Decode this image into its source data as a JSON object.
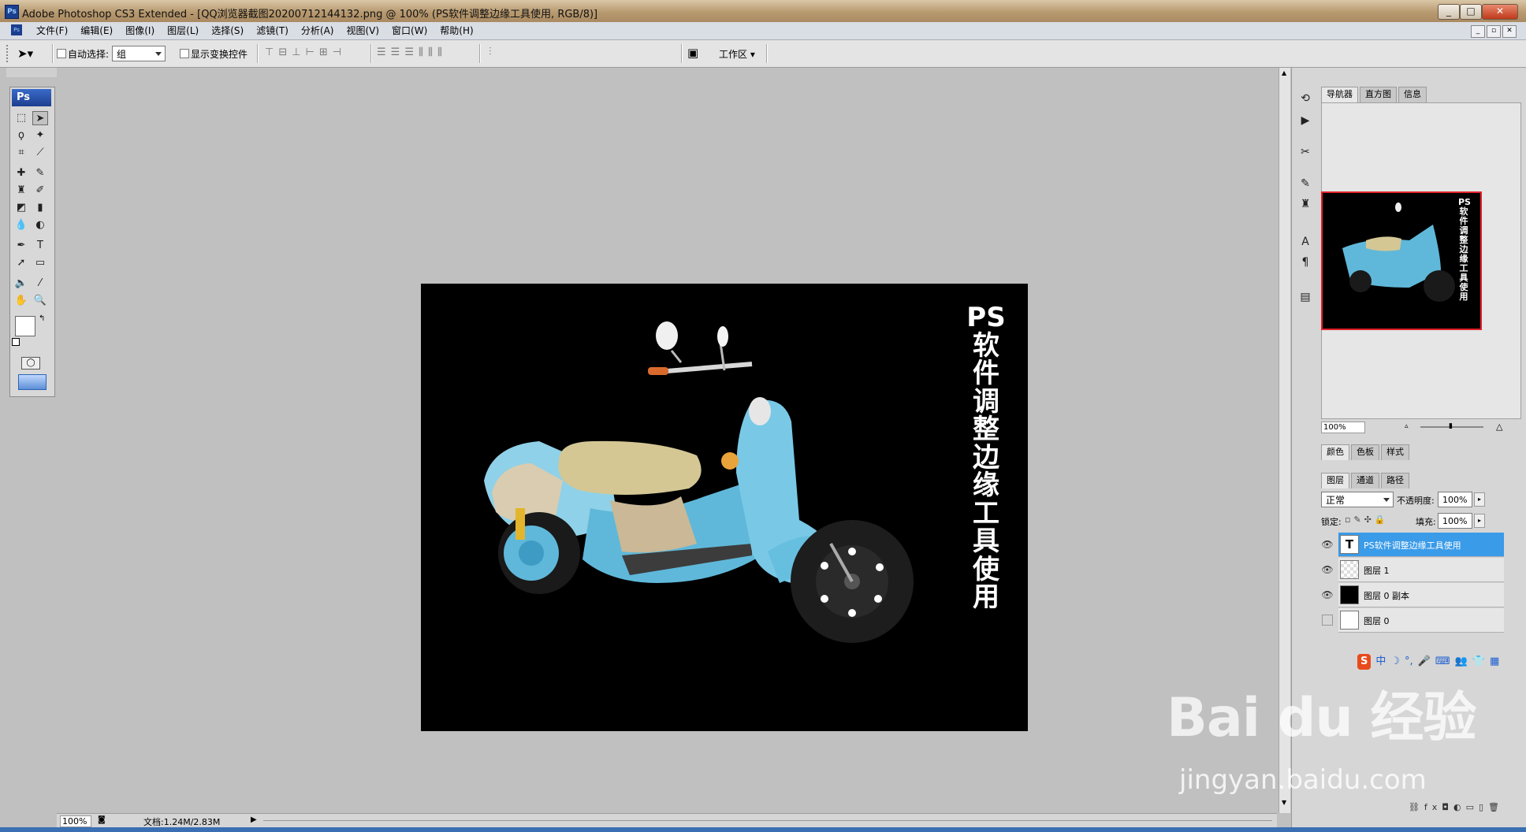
{
  "window": {
    "title": "Adobe Photoshop CS3 Extended - [QQ浏览器截图20200712144132.png @ 100% (PS软件调整边缘工具使用, RGB/8)]",
    "app_icon": "Ps",
    "buttons": [
      "minimize-icon",
      "maximize-icon",
      "close-icon"
    ],
    "btn_min": "_",
    "btn_max": "□",
    "btn_close": "✕"
  },
  "menubar": {
    "items": [
      "文件(F)",
      "编辑(E)",
      "图像(I)",
      "图层(L)",
      "选择(S)",
      "滤镜(T)",
      "分析(A)",
      "视图(V)",
      "窗口(W)",
      "帮助(H)"
    ]
  },
  "options": {
    "auto_select_label": "自动选择:",
    "auto_select_value": "组",
    "show_transform_label": "显示变换控件",
    "workspace_label": "工作区"
  },
  "toolbox": {
    "logo": "Ps"
  },
  "canvas": {
    "vertical_text": "PS软件调整边缘工具使用",
    "background_color": "#000000"
  },
  "statusbar": {
    "zoom": "100%",
    "doc_info": "文档:1.24M/2.83M"
  },
  "navigator": {
    "tabs": [
      "导航器",
      "直方图",
      "信息"
    ],
    "zoom": "100%"
  },
  "color_panel": {
    "tabs": [
      "颜色",
      "色板",
      "样式"
    ]
  },
  "layers_panel": {
    "tabs": [
      "图层",
      "通道",
      "路径"
    ],
    "blend_mode": "正常",
    "opacity_label": "不透明度:",
    "opacity": "100%",
    "lock_label": "锁定:",
    "fill_label": "填充:",
    "fill": "100%",
    "layers": [
      {
        "name": "PS软件调整边缘工具使用",
        "type": "text",
        "visible": true,
        "selected": true
      },
      {
        "name": "图层 1",
        "type": "image",
        "visible": true,
        "selected": false
      },
      {
        "name": "图层 0 副本",
        "type": "fill",
        "visible": true,
        "selected": false
      },
      {
        "name": "图层 0",
        "type": "image",
        "visible": false,
        "selected": false
      }
    ],
    "text_layer_glyph": "T",
    "eye_glyph": "👁"
  },
  "ime_bar": [
    "S",
    "中",
    "·",
    "☽",
    "°,",
    "🎤",
    "⌨",
    "👥",
    "👕",
    "▦"
  ],
  "watermark": {
    "main": "Bai du 经验",
    "sub": "jingyan.baidu.com"
  }
}
